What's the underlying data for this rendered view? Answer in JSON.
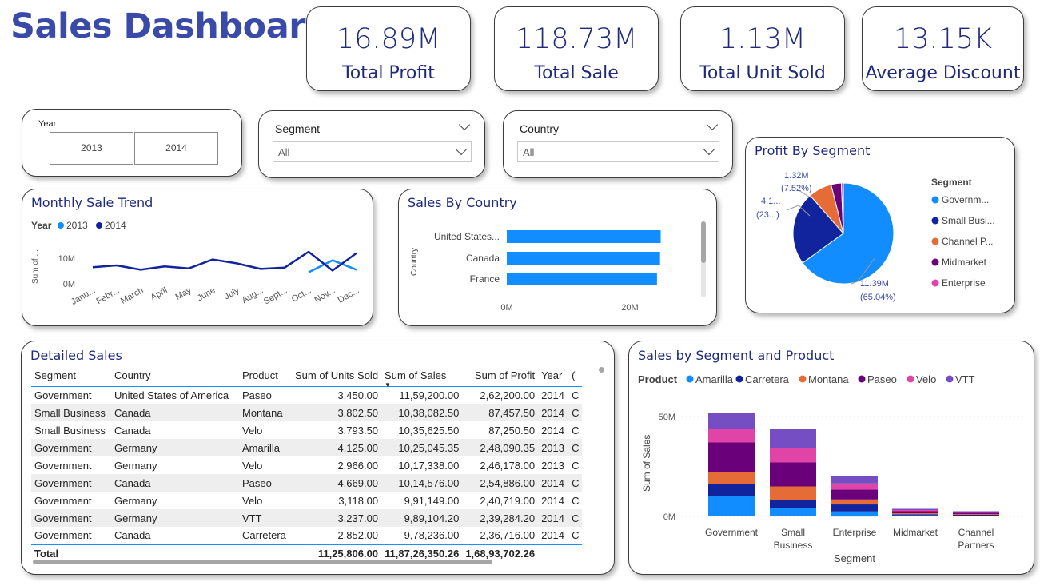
{
  "page_title": "Sales Dashboard",
  "kpis": [
    {
      "value": "16.89M",
      "label": "Total  Profit"
    },
    {
      "value": "118.73M",
      "label": "Total  Sale"
    },
    {
      "value": "1.13M",
      "label": "Total  Unit  Sold"
    },
    {
      "value": "13.15K",
      "label": "Average  Discount"
    }
  ],
  "year_slicer": {
    "label": "Year",
    "options": [
      "2013",
      "2014"
    ]
  },
  "segment_slicer": {
    "label": "Segment",
    "value": "All"
  },
  "country_slicer": {
    "label": "Country",
    "value": "All"
  },
  "colors": {
    "accent_dark": "#1f2a7c",
    "light_blue": "#118dff",
    "dark_blue": "#12239e",
    "orange": "#e66c37",
    "purple": "#6b007b",
    "pink": "#e044a7",
    "violet": "#744ec2"
  },
  "monthly_trend": {
    "title": "Monthly Sale Trend",
    "legend_title": "Year",
    "ylabel": "Sum of ...",
    "chart_data": {
      "type": "line",
      "categories": [
        "Janu...",
        "Febr...",
        "March",
        "April",
        "May",
        "June",
        "July",
        "Aug...",
        "Sept...",
        "Oct...",
        "Nov...",
        "Dec..."
      ],
      "ylim": [
        0,
        15
      ],
      "yticks": [
        "10M",
        "0M"
      ],
      "series": [
        {
          "name": "2013",
          "color": "#118dff",
          "values": [
            null,
            null,
            null,
            null,
            null,
            null,
            null,
            null,
            null,
            4.5,
            9.2,
            5.5
          ]
        },
        {
          "name": "2014",
          "color": "#12239e",
          "values": [
            6.5,
            7.2,
            5.5,
            6.8,
            6.0,
            9.5,
            8.0,
            5.8,
            6.3,
            12.5,
            5.2,
            12.0
          ]
        }
      ]
    }
  },
  "sales_by_country": {
    "title": "Sales By Country",
    "ylabel": "Country",
    "chart_data": {
      "type": "bar",
      "categories": [
        "United States...",
        "Canada",
        "France"
      ],
      "values": [
        25,
        24.9,
        24.4
      ],
      "xlim": [
        0,
        30
      ],
      "xticks": [
        {
          "v": 0,
          "label": "0M"
        },
        {
          "v": 20,
          "label": "20M"
        }
      ]
    }
  },
  "profit_by_segment": {
    "title": "Profit By Segment",
    "legend_title": "Segment",
    "legend": [
      "Governm...",
      "Small Busi...",
      "Channel P...",
      "Midmarket",
      "Enterprise"
    ],
    "labels": [
      {
        "value": "11.39M",
        "pct": "(65.04%)"
      },
      {
        "value": "4.1...",
        "pct": "(23...)"
      },
      {
        "value": "1.32M",
        "pct": "(7.52%)"
      }
    ],
    "chart_data": {
      "type": "pie",
      "slices": [
        {
          "name": "Government",
          "value": 65.04,
          "color": "#118dff"
        },
        {
          "name": "Small Business",
          "value": 23.5,
          "color": "#12239e"
        },
        {
          "name": "Channel Partners",
          "value": 7.52,
          "color": "#e66c37"
        },
        {
          "name": "Midmarket",
          "value": 3.3,
          "color": "#6b007b"
        },
        {
          "name": "Enterprise",
          "value": 0.64,
          "color": "#e044a7"
        }
      ]
    }
  },
  "detailed_sales": {
    "title": "Detailed Sales",
    "columns": [
      "Segment",
      "Country",
      "Product",
      "Sum of Units Sold",
      "Sum of Sales",
      "Sum of Profit",
      "Year"
    ],
    "rows": [
      [
        "Government",
        "United States of America",
        "Paseo",
        "3,450.00",
        "11,59,200.00",
        "2,62,200.00",
        "2014"
      ],
      [
        "Small Business",
        "Canada",
        "Montana",
        "3,802.50",
        "10,38,082.50",
        "87,457.50",
        "2014"
      ],
      [
        "Small Business",
        "Canada",
        "Velo",
        "3,793.50",
        "10,35,625.50",
        "87,250.50",
        "2014"
      ],
      [
        "Government",
        "Germany",
        "Amarilla",
        "4,125.00",
        "10,25,045.35",
        "2,48,090.35",
        "2013"
      ],
      [
        "Government",
        "Germany",
        "Velo",
        "2,966.00",
        "10,17,338.00",
        "2,46,178.00",
        "2013"
      ],
      [
        "Government",
        "Canada",
        "Paseo",
        "4,669.00",
        "10,14,576.00",
        "2,54,886.00",
        "2014"
      ],
      [
        "Government",
        "Germany",
        "Velo",
        "3,118.00",
        "9,91,149.00",
        "2,40,719.00",
        "2014"
      ],
      [
        "Government",
        "Germany",
        "VTT",
        "3,237.00",
        "9,89,104.20",
        "2,39,284.20",
        "2014"
      ],
      [
        "Government",
        "Canada",
        "Carretera",
        "2,852.00",
        "9,78,236.00",
        "2,36,716.00",
        "2014"
      ]
    ],
    "total": {
      "label": "Total",
      "units": "11,25,806.00",
      "sales": "11,87,26,350.26",
      "profit": "1,68,93,702.26"
    }
  },
  "sales_by_segment_product": {
    "title": "Sales by Segment and Product",
    "legend_title": "Product",
    "xlabel": "Segment",
    "ylabel": "Sum of Sales",
    "chart_data": {
      "type": "bar",
      "stacked": true,
      "categories": [
        "Government",
        "Small|Business",
        "Enterprise",
        "Midmarket",
        "Channel|Partners"
      ],
      "ylim": [
        0,
        60
      ],
      "yticks": [
        {
          "v": 0,
          "label": "0M"
        },
        {
          "v": 50,
          "label": "50M"
        }
      ],
      "series": [
        {
          "name": "Amarilla",
          "color": "#118dff",
          "values": [
            10,
            4,
            2.5,
            0.6,
            0.4
          ]
        },
        {
          "name": "Carretera",
          "color": "#12239e",
          "values": [
            6,
            4,
            3.5,
            0.5,
            0.4
          ]
        },
        {
          "name": "Montana",
          "color": "#e66c37",
          "values": [
            6,
            7,
            2.5,
            0.5,
            0.4
          ]
        },
        {
          "name": "Paseo",
          "color": "#6b007b",
          "values": [
            15,
            12,
            5,
            1,
            0.6
          ]
        },
        {
          "name": "Velo",
          "color": "#e044a7",
          "values": [
            7,
            7,
            3,
            0.6,
            0.4
          ]
        },
        {
          "name": "VTT",
          "color": "#744ec2",
          "values": [
            8,
            10,
            3.5,
            0.6,
            0.4
          ]
        }
      ]
    }
  }
}
